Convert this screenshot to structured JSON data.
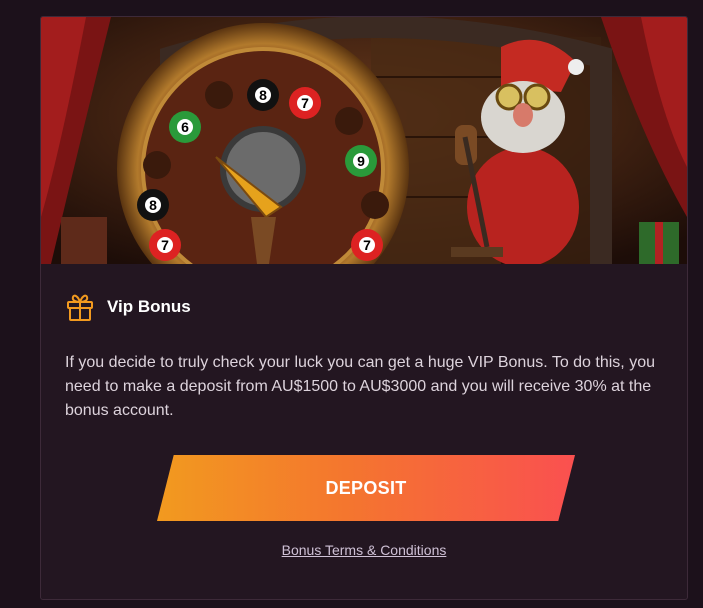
{
  "banner": {
    "image_description": "Slot game artwork: golden roulette-style wheel with numbered billiard balls and a gnome with goggles pulling a lever",
    "ball_numbers": [
      "8",
      "7",
      "6",
      "9",
      "8",
      "7",
      "7"
    ]
  },
  "bonus": {
    "icon": "gift-icon",
    "title": "Vip Bonus",
    "description": "If you decide to truly check your luck you can get a huge VIP Bonus. To do this, you need to make a deposit from AU$1500 to AU$3000 and you will receive 30% at the bonus account.",
    "deposit_label": "DEPOSIT",
    "terms_label": "Bonus Terms & Conditions"
  },
  "colors": {
    "page_bg": "#1c111b",
    "card_bg": "#231621",
    "accent_orange": "#f29a1f",
    "accent_red": "#fa5050"
  }
}
